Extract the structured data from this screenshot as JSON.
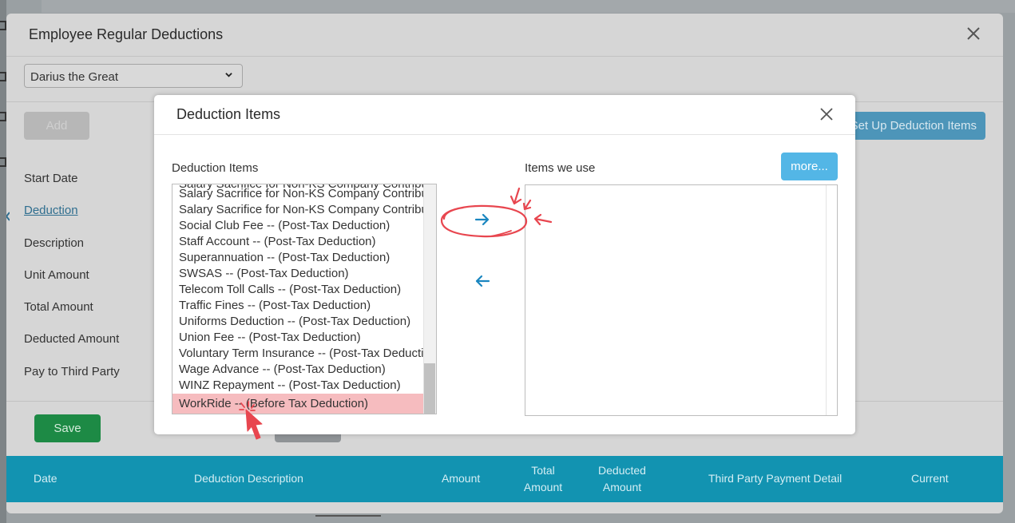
{
  "outer_modal": {
    "title": "Employee Regular Deductions",
    "employee_select": {
      "value": "Darius the Great"
    },
    "add_label": "Add",
    "setup_label": "Set Up Deduction Items",
    "form_labels": {
      "start_date": "Start Date",
      "deduction": "Deduction",
      "description": "Description",
      "unit_amount": "Unit Amount",
      "total_amount": "Total Amount",
      "deducted_amount": "Deducted Amount",
      "pay_to_third_party": "Pay to Third Party"
    },
    "save_label": "Save",
    "table_headers": {
      "date": "Date",
      "deduction_description": "Deduction Description",
      "amount": "Amount",
      "total_amount_1": "Total",
      "total_amount_2": "Amount",
      "deducted_amount_1": "Deducted",
      "deducted_amount_2": "Amount",
      "third_party": "Third Party Payment Detail",
      "current": "Current"
    }
  },
  "inner_modal": {
    "title": "Deduction Items",
    "left_label": "Deduction Items",
    "right_label": "Items we use",
    "more_label": "more...",
    "items": [
      "Salary Sacrifice for Non-KS Company Contribution",
      "Salary Sacrifice for Non-KS Company Contribution",
      "Social Club Fee -- (Post-Tax Deduction)",
      "Staff Account -- (Post-Tax Deduction)",
      "Superannuation -- (Post-Tax Deduction)",
      "SWSAS -- (Post-Tax Deduction)",
      "Telecom Toll Calls -- (Post-Tax Deduction)",
      "Traffic Fines -- (Post-Tax Deduction)",
      "Uniforms Deduction -- (Post-Tax Deduction)",
      "Union Fee -- (Post-Tax Deduction)",
      "Voluntary Term Insurance -- (Post-Tax Deduction)",
      "Wage Advance -- (Post-Tax Deduction)",
      "WINZ Repayment -- (Post-Tax Deduction)",
      "WorkRide -- (Before Tax Deduction)"
    ],
    "selected_item": "WorkRide -- (Before Tax Deduction)"
  },
  "colors": {
    "table_header": "#1293b1",
    "save": "#1d8a45",
    "more": "#53b6e6",
    "selection": "#f6bcbf",
    "arrow": "#1a86c0",
    "annotation": "#e8464f"
  },
  "icons": [
    "close-icon",
    "chevron-down-icon",
    "arrow-right-icon",
    "arrow-left-icon"
  ]
}
